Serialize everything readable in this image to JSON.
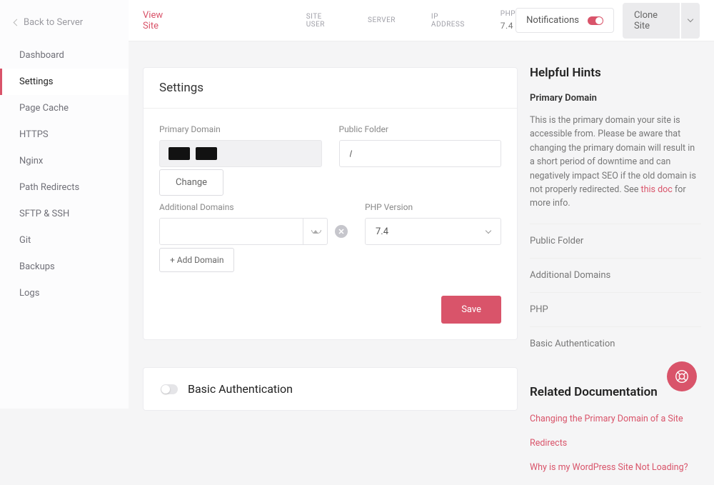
{
  "back_link": "Back to Server",
  "nav": [
    {
      "label": "Dashboard"
    },
    {
      "label": "Settings"
    },
    {
      "label": "Page Cache"
    },
    {
      "label": "HTTPS"
    },
    {
      "label": "Nginx"
    },
    {
      "label": "Path Redirects"
    },
    {
      "label": "SFTP & SSH"
    },
    {
      "label": "Git"
    },
    {
      "label": "Backups"
    },
    {
      "label": "Logs"
    }
  ],
  "topbar": {
    "view_site": "View Site",
    "info": {
      "site_user_label": "SITE USER",
      "server_label": "SERVER",
      "ip_label": "IP ADDRESS",
      "php_label": "PHP",
      "php_value": "7.4"
    },
    "notifications_label": "Notifications",
    "clone_label": "Clone Site"
  },
  "settings": {
    "heading": "Settings",
    "primary_domain_label": "Primary Domain",
    "public_folder_label": "Public Folder",
    "public_folder_value": "/",
    "change_btn": "Change",
    "additional_label": "Additional Domains",
    "php_version_label": "PHP Version",
    "php_version_value": "7.4",
    "add_domain_btn": "+ Add Domain",
    "save_btn": "Save"
  },
  "basic_auth": {
    "title": "Basic Authentication"
  },
  "hints": {
    "heading": "Helpful Hints",
    "primary_title": "Primary Domain",
    "primary_text_a": "This is the primary domain your site is accessible from. Please be aware that changing the primary domain will result in a short period of downtime and can negatively impact SEO if the old domain is not properly redirected. See ",
    "primary_text_link": "this doc",
    "primary_text_b": " for more info.",
    "items": [
      "Public Folder",
      "Additional Domains",
      "PHP",
      "Basic Authentication"
    ]
  },
  "related": {
    "heading": "Related Documentation",
    "links": [
      "Changing the Primary Domain of a Site",
      "Redirects",
      "Why is my WordPress Site Not Loading?"
    ]
  }
}
